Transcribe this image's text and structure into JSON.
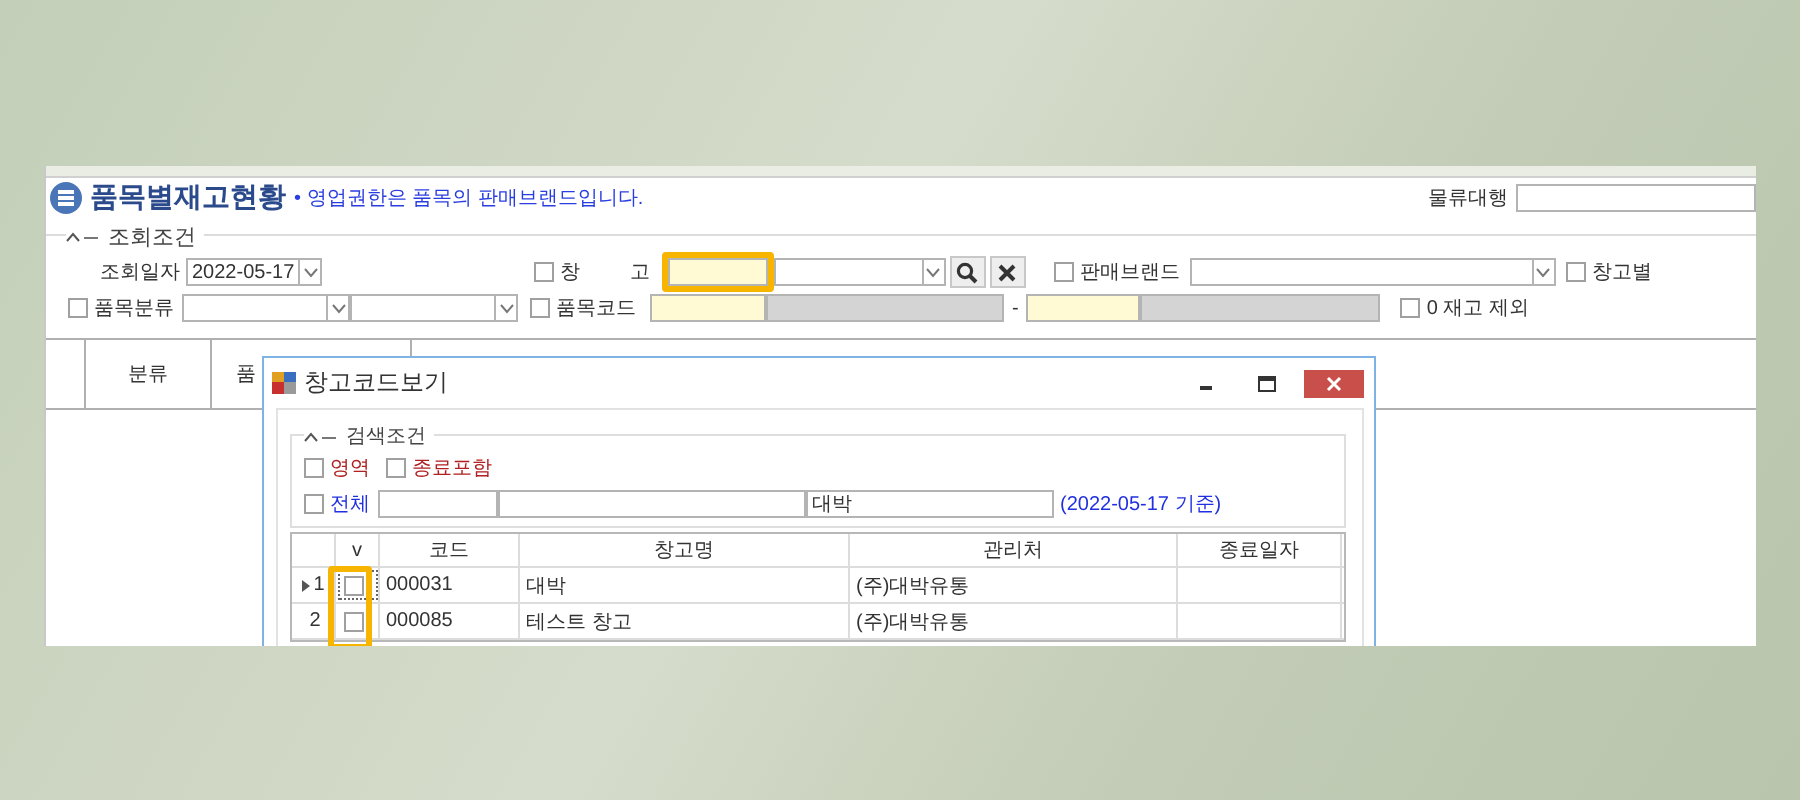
{
  "window": {
    "title": "품목별재고현황",
    "note": "• 영업권한은 품목의 판매브랜드입니다."
  },
  "logistics": {
    "label": "물류대행"
  },
  "filter_group": {
    "title": "조회조건",
    "date": {
      "label": "조회일자",
      "value": "2022-05-17"
    },
    "warehouse": {
      "label": "창 고",
      "checked": false
    },
    "brand": {
      "label": "판매브랜드",
      "checked": false
    },
    "by_warehouse": {
      "label": "창고별",
      "checked": false
    },
    "category": {
      "label": "품목분류",
      "checked": false
    },
    "item_code": {
      "label": "품목코드",
      "checked": false,
      "separator": "-"
    },
    "exclude_zero": {
      "label": "0 재고 제외",
      "checked": false
    }
  },
  "grid": {
    "columns": [
      "분류",
      "품"
    ]
  },
  "dialog": {
    "title": "창고코드보기",
    "group_title": "검색조건",
    "options": [
      {
        "label": "영역",
        "checked": false
      },
      {
        "label": "종료포함",
        "checked": false
      }
    ],
    "all": {
      "label": "전체",
      "checked": false
    },
    "name_value": "대박",
    "basis": "(2022-05-17 기준)",
    "columns": [
      "v",
      "코드",
      "창고명",
      "관리처",
      "종료일자"
    ],
    "rows": [
      {
        "number": "1",
        "selected": true,
        "checked": false,
        "code": "000031",
        "name": "대박",
        "manager": "(주)대박유통"
      },
      {
        "number": "2",
        "selected": false,
        "checked": false,
        "code": "000085",
        "name": "테스트 창고",
        "manager": "(주)대박유통"
      }
    ]
  }
}
